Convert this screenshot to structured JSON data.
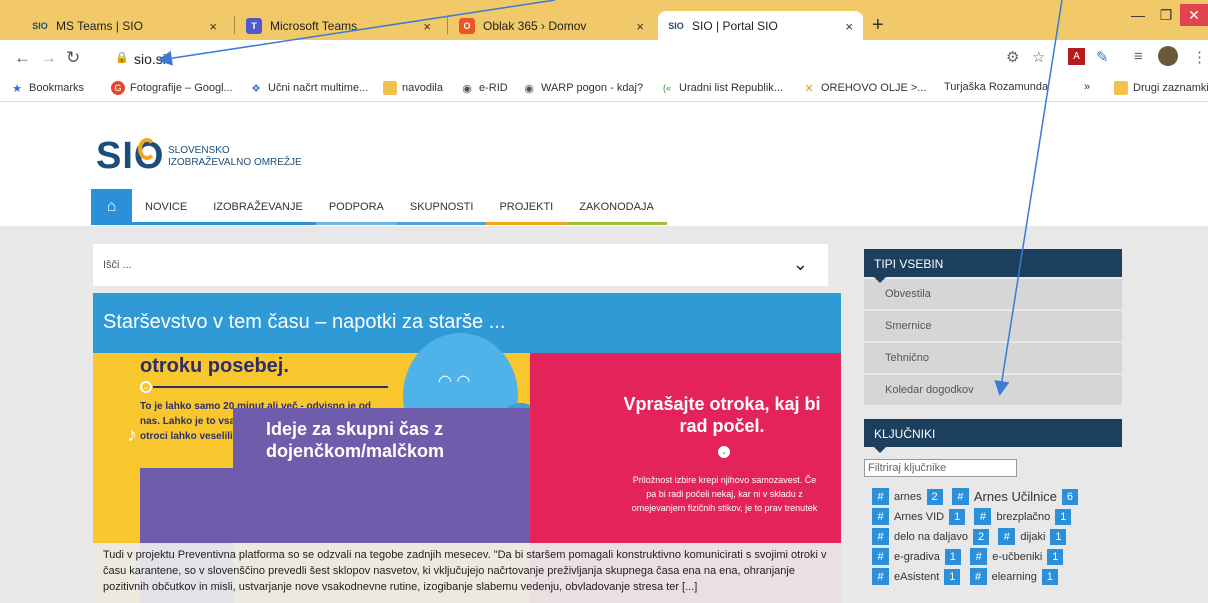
{
  "browser": {
    "tabs": [
      {
        "favicon": "SIO",
        "title": "MS Teams | SIO",
        "close": "×",
        "active": false
      },
      {
        "favicon": "T",
        "title": "Microsoft Teams",
        "close": "×",
        "active": false
      },
      {
        "favicon": "O",
        "title": "Oblak 365 › Domov",
        "close": "×",
        "active": false
      },
      {
        "favicon": "SIO",
        "title": "SIO | Portal SIO",
        "close": "×",
        "active": true
      }
    ],
    "new_tab": "+",
    "url": "sio.si",
    "colors": {
      "tabbar": "#f2c969",
      "active_tab": "#ffffff"
    }
  },
  "bookmarks": [
    {
      "icon": "star-icon",
      "label": "Bookmarks"
    },
    {
      "icon": "google-photos-icon",
      "label": "Fotografije – Googl..."
    },
    {
      "icon": "book-icon",
      "label": "Učni načrt multime..."
    },
    {
      "icon": "folder-icon",
      "label": "navodila"
    },
    {
      "icon": "globe-icon",
      "label": "e-RID"
    },
    {
      "icon": "globe-icon",
      "label": "WARP pogon - kdaj?"
    },
    {
      "icon": "uradni-list-icon",
      "label": "Uradni list Republik..."
    },
    {
      "icon": "butterfly-icon",
      "label": "OREHOVO OLJE >..."
    },
    {
      "icon": "none",
      "label": "Turjaška Rozamunda"
    },
    {
      "icon": "more-icon",
      "label": "»"
    },
    {
      "icon": "folder-icon",
      "label": "Drugi zaznamki"
    }
  ],
  "site": {
    "logo": "SIO",
    "logo_line1": "SLOVENSKO",
    "logo_line2": "IZOBRAŽEVALNO OMREŽJE",
    "menu": [
      {
        "label": "NOVICE",
        "bar": "#2b90d9"
      },
      {
        "label": "IZOBRAŽEVANJE",
        "bar": "#2b90d9"
      },
      {
        "label": "PODPORA",
        "bar": "#6fb7e0"
      },
      {
        "label": "SKUPNOSTI",
        "bar": "#4aa3df"
      },
      {
        "label": "PROJEKTI",
        "bar": "#f2a61c"
      },
      {
        "label": "ZAKONODAJA",
        "bar": "#9ac33c"
      }
    ],
    "search_placeholder": "Išči ...",
    "hero": {
      "title": "Starševstvo v tem času – napotki za starše ...",
      "left_heading": "otroku posebej.",
      "left_text": "To je lahko samo 20 minut ali več - odvisno je od nas. Lahko je to vsak dan ob istem času, da se bodo otroci lahko veselili skupnega časa.",
      "right_heading": "Vprašajte otroka, kaj bi rad počel.",
      "right_text": "Priložnost izbire krepi njihovo samozavest. Če pa bi radi počeli nekaj, kar ni v skladu z omejevanjem fizičnih stikov, je to prav trenutek",
      "purple_heading": "Ideje za skupni čas z dojenčkom/malčkom",
      "excerpt": "Tudi v projektu Preventivna platforma so se odzvali na tegobe zadnjih mesecev. \"Da bi staršem pomagali konstruktivno komunicirati s svojimi otroki v času karantene, so v slovenščino prevedli šest sklopov nasvetov, ki vključujejo načrtovanje preživljanja skupnega časa ena na ena, ohranjanje pozitivnih občutkov in misli, ustvarjanje nove vsakodnevne rutine, izogibanje slabemu vedenju, obvladovanje stresa ter [...]"
    },
    "sidebar": {
      "types_title": "TIPI VSEBIN",
      "types": [
        "Obvestila",
        "Smernice",
        "Tehnično",
        "Koledar dogodkov"
      ],
      "keywords_title": "KLJUČNIKI",
      "filter_placeholder": "Filtriraj ključnike",
      "tags": [
        {
          "label": "arnes",
          "count": "2"
        },
        {
          "label": "Arnes Učilnice",
          "count": "6"
        },
        {
          "label": "Arnes VID",
          "count": "1"
        },
        {
          "label": "brezplačno",
          "count": "1"
        },
        {
          "label": "delo na daljavo",
          "count": "2"
        },
        {
          "label": "dijaki",
          "count": "1"
        },
        {
          "label": "e-gradiva",
          "count": "1"
        },
        {
          "label": "e-učbeniki",
          "count": "1"
        },
        {
          "label": "eAsistent",
          "count": "1"
        },
        {
          "label": "elearning",
          "count": "1"
        }
      ]
    },
    "colors": {
      "brand_blue": "#2b90d9",
      "navy": "#1b3f5c",
      "hero_blue": "#2f9ad6",
      "yellow": "#f8c72d",
      "pink": "#e4235a",
      "purple": "#6f5dab"
    }
  }
}
